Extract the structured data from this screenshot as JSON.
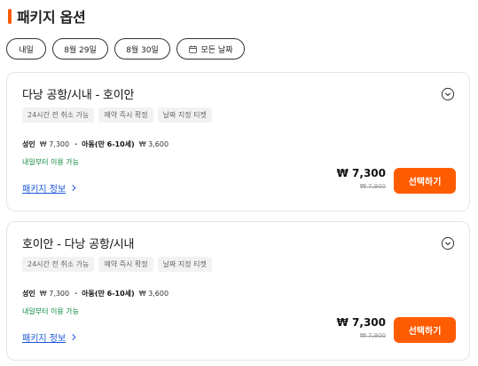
{
  "section": {
    "title": "패키지 옵션"
  },
  "dates": {
    "tomorrow": "내일",
    "aug29": "8월 29일",
    "aug30": "8월 30일",
    "all": "모든 날짜"
  },
  "packages": [
    {
      "title": "다낭 공항/시내 - 호이안",
      "tags": [
        "24시간 전 취소 가능",
        "예약 즉시 확정",
        "날짜 지정 티켓"
      ],
      "adult_label": "성인",
      "adult_price": "₩ 7,300",
      "child_label": "아동(만 6-10세)",
      "child_price": "₩ 3,600",
      "availability": "내일부터 이용 가능",
      "info_link": "패키지 정보",
      "price_now": "₩ 7,300",
      "price_old": "₩ 7,900",
      "select_label": "선택하기"
    },
    {
      "title": "호이안 - 다낭 공항/시내",
      "tags": [
        "24시간 전 취소 가능",
        "예약 즉시 확정",
        "날짜 지정 티켓"
      ],
      "adult_label": "성인",
      "adult_price": "₩ 7,300",
      "child_label": "아동(만 6-10세)",
      "child_price": "₩ 3,600",
      "availability": "내일부터 이용 가능",
      "info_link": "패키지 정보",
      "price_now": "₩ 7,300",
      "price_old": "₩ 7,900",
      "select_label": "선택하기"
    }
  ],
  "icons": {
    "calendar": "calendar-icon",
    "expand": "chevron-down-circle-icon",
    "link_arrow": "chevron-right-icon"
  },
  "colors": {
    "accent": "#ff5b00",
    "link": "#1a56d6",
    "available": "#0b8a3e"
  }
}
